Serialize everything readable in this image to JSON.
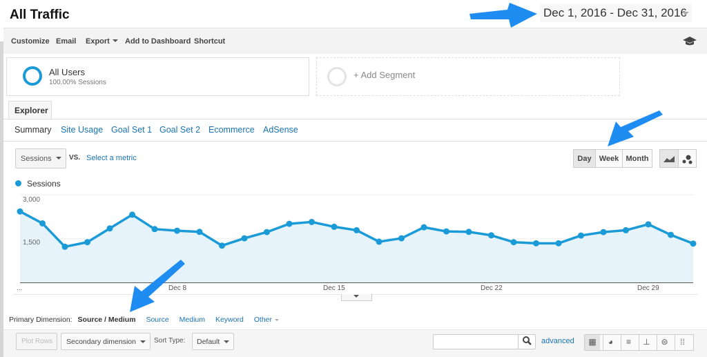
{
  "header": {
    "title": "All Traffic",
    "date_range": "Dec 1, 2016 - Dec 31, 2016"
  },
  "toolbar": {
    "customize": "Customize",
    "email": "Email",
    "export": "Export",
    "add_to_dashboard": "Add to Dashboard",
    "shortcut": "Shortcut",
    "help_icon": "graduation-cap-icon"
  },
  "segments": {
    "active": {
      "name": "All Users",
      "detail": "100.00% Sessions"
    },
    "add": "+ Add Segment"
  },
  "explorer": {
    "tab": "Explorer",
    "subtabs": [
      "Summary",
      "Site Usage",
      "Goal Set 1",
      "Goal Set 2",
      "Ecommerce",
      "AdSense"
    ],
    "active_subtab": "Summary"
  },
  "metric": {
    "selected": "Sessions",
    "vs": "VS.",
    "select_metric": "Select a metric"
  },
  "granularity": {
    "options": [
      "Day",
      "Week",
      "Month"
    ],
    "active": "Day"
  },
  "accent": "#1a9ad6",
  "chart_data": {
    "type": "area",
    "series": [
      {
        "name": "Sessions",
        "values": [
          2430,
          2025,
          1228,
          1383,
          1852,
          2320,
          1828,
          1774,
          1734,
          1266,
          1516,
          1727,
          2009,
          2072,
          1908,
          1790,
          1399,
          1516,
          1891,
          1751,
          1734,
          1617,
          1383,
          1345,
          1345,
          1610,
          1727,
          1790,
          1992,
          1633,
          1336
        ]
      }
    ],
    "x": [
      "Dec 1",
      "Dec 2",
      "Dec 3",
      "Dec 4",
      "Dec 5",
      "Dec 6",
      "Dec 7",
      "Dec 8",
      "Dec 9",
      "Dec 10",
      "Dec 11",
      "Dec 12",
      "Dec 13",
      "Dec 14",
      "Dec 15",
      "Dec 16",
      "Dec 17",
      "Dec 18",
      "Dec 19",
      "Dec 20",
      "Dec 21",
      "Dec 22",
      "Dec 23",
      "Dec 24",
      "Dec 25",
      "Dec 26",
      "Dec 27",
      "Dec 28",
      "Dec 29",
      "Dec 30",
      "Dec 31"
    ],
    "x_tick_labels": [
      "...",
      "Dec 8",
      "Dec 15",
      "Dec 22",
      "Dec 29"
    ],
    "y_tick_labels": [
      "3,000",
      "1,500"
    ],
    "ylim": [
      0,
      3000
    ],
    "grid": true,
    "legend": "top-left"
  },
  "dimension": {
    "label": "Primary Dimension:",
    "active": "Source / Medium",
    "options": [
      "Source",
      "Medium",
      "Keyword"
    ],
    "other": "Other"
  },
  "table_toolbar": {
    "plot_rows": "Plot Rows",
    "secondary": "Secondary dimension",
    "sort_label": "Sort Type:",
    "sort_value": "Default",
    "search_placeholder": "",
    "advanced": "advanced"
  }
}
